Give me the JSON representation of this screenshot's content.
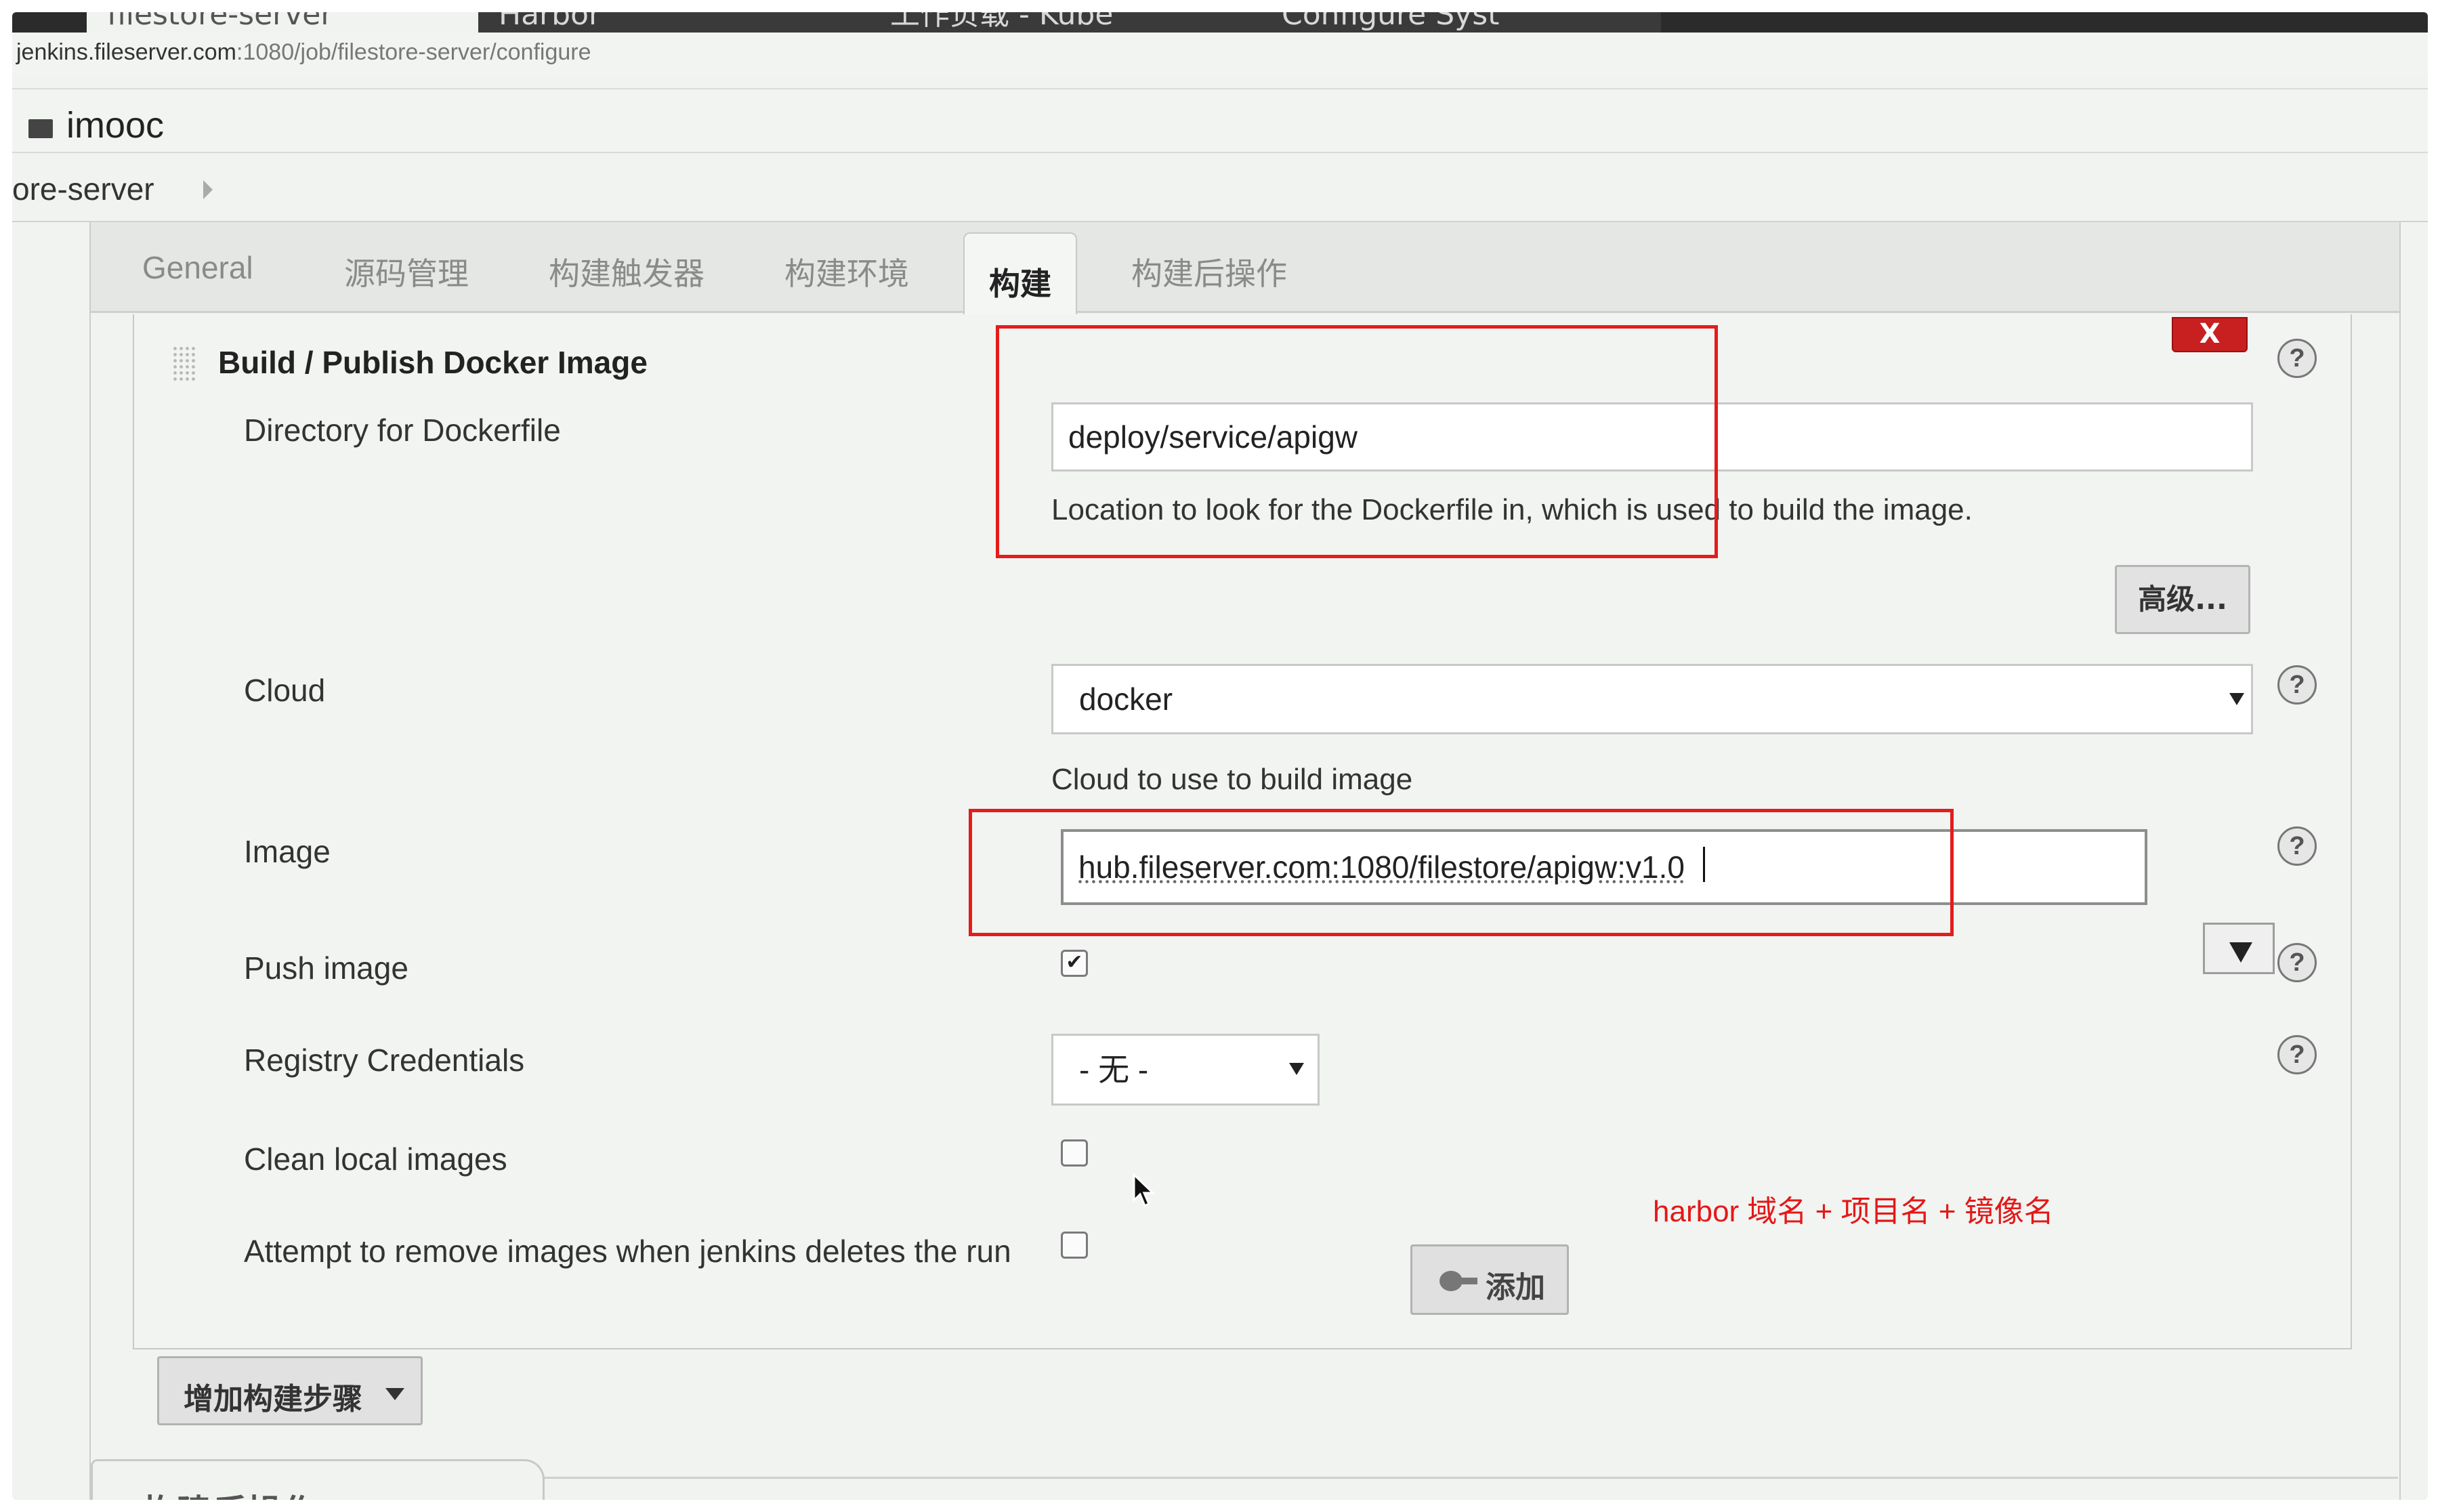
{
  "browser": {
    "tabs": [
      "filestore-server",
      "Harbor",
      "工作负载 - Kube",
      "Configure Syst"
    ],
    "url_host": "jenkins.fileserver.com",
    "url_path": ":1080/job/filestore-server/configure"
  },
  "header": {
    "title": "imooc"
  },
  "breadcrumb": {
    "item": "ore-server"
  },
  "config_tabs": [
    "General",
    "源码管理",
    "构建触发器",
    "构建环境",
    "构建",
    "构建后操作"
  ],
  "build_step": {
    "title": "Build / Publish Docker Image",
    "delete_label": "X",
    "help_label": "?",
    "dockerfile": {
      "label": "Directory for Dockerfile",
      "value": "deploy/service/apigw",
      "description": "Location to look for the Dockerfile in, which is used to build the image."
    },
    "advanced_label": "高级...",
    "cloud": {
      "label": "Cloud",
      "value": "docker",
      "description": "Cloud to use to build image"
    },
    "image": {
      "label": "Image",
      "value": "hub.fileserver.com:1080/filestore/apigw:v1.0"
    },
    "push_image": {
      "label": "Push image",
      "checked": true,
      "check_mark": "✔"
    },
    "annotation": "harbor 域名 + 项目名 + 镜像名",
    "registry_credentials": {
      "label": "Registry Credentials",
      "value": "- 无 -",
      "add_label": "添加"
    },
    "clean_local_images": {
      "label": "Clean local images",
      "checked": false
    },
    "remove_images": {
      "label": "Attempt to remove images when jenkins deletes the run",
      "checked": false
    }
  },
  "add_step_label": "增加构建步骤",
  "post_build_heading": "构建后操作",
  "colors": {
    "annotation_red": "#e41c1c",
    "delete_red": "#c82020",
    "background": "#f0f3f0"
  }
}
